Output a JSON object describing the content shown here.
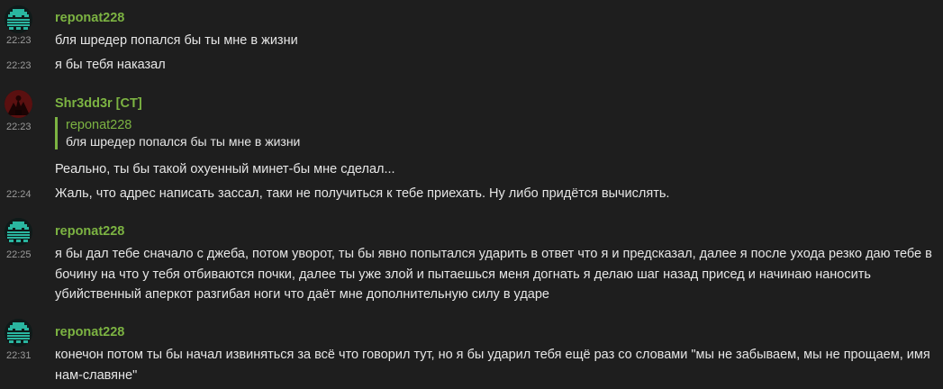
{
  "messages": [
    {
      "user": "reponat228",
      "lines": [
        {
          "time": "22:23",
          "text": "бля шредер попался бы ты мне в жизни"
        },
        {
          "time": "22:23",
          "text": "я бы тебя наказал"
        }
      ]
    },
    {
      "user": "Shr3dd3r [CT]",
      "time": "22:23",
      "quote": {
        "user": "reponat228",
        "text": "бля шредер попался бы ты мне в жизни"
      },
      "lines": [
        {
          "time": "",
          "text": "Реально, ты бы такой охуенный минет-бы мне сделал..."
        },
        {
          "time": "22:24",
          "text": "Жаль, что адрес написать зассал, таки не получиться к тебе приехать. Ну либо придётся вычислять."
        }
      ]
    },
    {
      "user": "reponat228",
      "lines": [
        {
          "time": "22:25",
          "text": "я бы дал тебе сначало с джеба, потом уворот, ты бы явно попытался ударить в ответ что я и предсказал, далее я после ухода резко даю тебе в бочину на что у тебя отбиваются почки, далее ты уже злой и пытаешься меня догнать я делаю шаг назад присед и начинаю наносить убийственный аперкот разгибая ноги что даёт мне дополнительную силу в ударе"
        }
      ]
    },
    {
      "user": "reponat228",
      "lines": [
        {
          "time": "22:31",
          "text": "конечон потом ты бы начал извиняться за всё что говорил тут, но я бы ударил тебя ещё раз со словами \"мы не забываем, мы не прощаем, имя нам-славяне\""
        }
      ]
    }
  ],
  "colors": {
    "background": "#1e1e1e",
    "username": "#7cb342",
    "text": "#e6e6e6",
    "timestamp": "#9a9a9a",
    "quote_bar": "#7cb342"
  },
  "icons": {
    "reponat228_avatar": "pixel-ghost-avatar",
    "shr3dd3r_avatar": "dark-red-figure-avatar"
  }
}
